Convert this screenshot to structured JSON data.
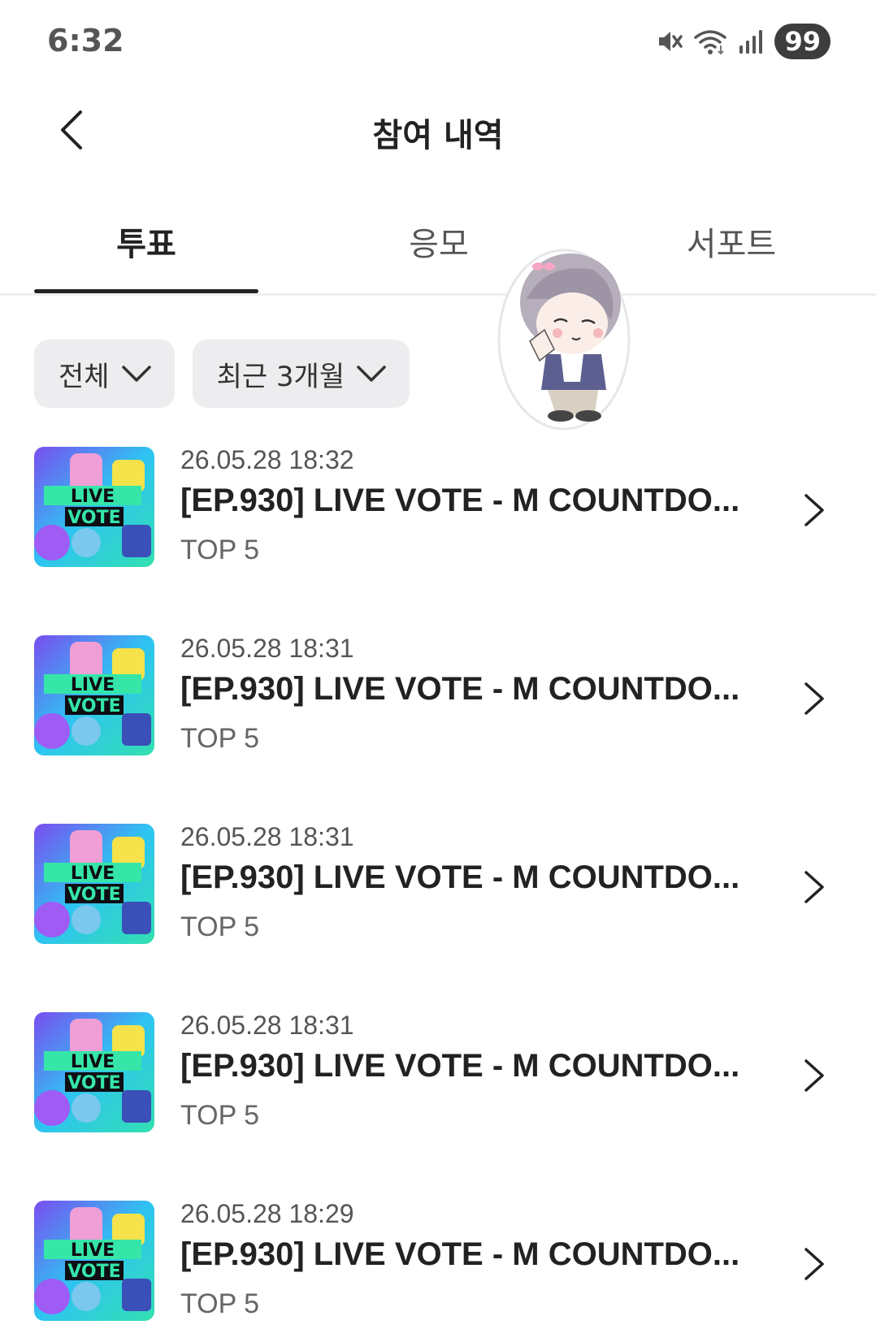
{
  "status_bar": {
    "time": "6:32",
    "icons": [
      "mute-icon",
      "wifi-icon",
      "signal-icon"
    ],
    "battery": "99"
  },
  "header": {
    "title": "참여 내역",
    "back_icon": "chevron-left-icon"
  },
  "tabs": [
    {
      "label": "투표",
      "active": true
    },
    {
      "label": "응모",
      "active": false
    },
    {
      "label": "서포트",
      "active": false
    }
  ],
  "filters": [
    {
      "label": "전체",
      "icon": "chevron-down-icon"
    },
    {
      "label": "최근 3개월",
      "icon": "chevron-down-icon"
    }
  ],
  "thumbnail": {
    "line1": "LIVE",
    "line2": "VOTE"
  },
  "votes": [
    {
      "date": "26.05.28 18:32",
      "title": "[EP.930] LIVE VOTE - M COUNTDO...",
      "subtitle": "TOP 5"
    },
    {
      "date": "26.05.28 18:31",
      "title": "[EP.930] LIVE VOTE - M COUNTDO...",
      "subtitle": "TOP 5"
    },
    {
      "date": "26.05.28 18:31",
      "title": "[EP.930] LIVE VOTE - M COUNTDO...",
      "subtitle": "TOP 5"
    },
    {
      "date": "26.05.28 18:31",
      "title": "[EP.930] LIVE VOTE - M COUNTDO...",
      "subtitle": "TOP 5"
    },
    {
      "date": "26.05.28 18:29",
      "title": "[EP.930] LIVE VOTE - M COUNTDO...",
      "subtitle": "TOP 5"
    }
  ],
  "colors": {
    "accent": "#222222",
    "chip_bg": "#ededf0",
    "divider": "#eeeeee"
  }
}
